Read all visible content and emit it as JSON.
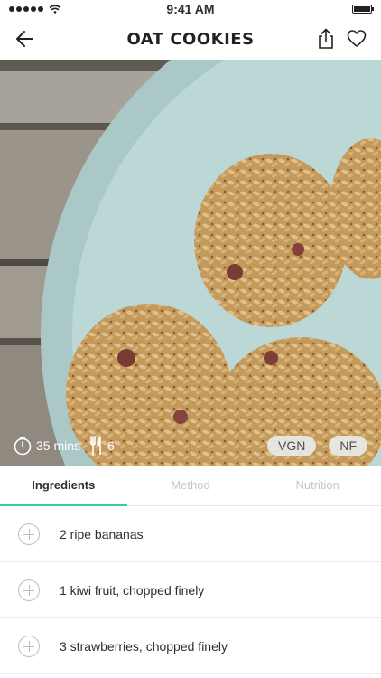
{
  "status": {
    "time": "9:41 AM"
  },
  "header": {
    "title": "OAT COOKIES"
  },
  "hero": {
    "image_alt": "Oat cookies on a pale blue plate",
    "time": "35 mins",
    "servings": "6",
    "badges": [
      "VGN",
      "NF"
    ]
  },
  "tabs": [
    {
      "label": "Ingredients",
      "active": true
    },
    {
      "label": "Method",
      "active": false
    },
    {
      "label": "Nutrition",
      "active": false
    }
  ],
  "ingredients": [
    "2 ripe bananas",
    "1 kiwi fruit, chopped finely",
    "3 strawberries, chopped finely"
  ],
  "colors": {
    "accent": "#3ccf8e",
    "plate": "#b9d6d4"
  }
}
